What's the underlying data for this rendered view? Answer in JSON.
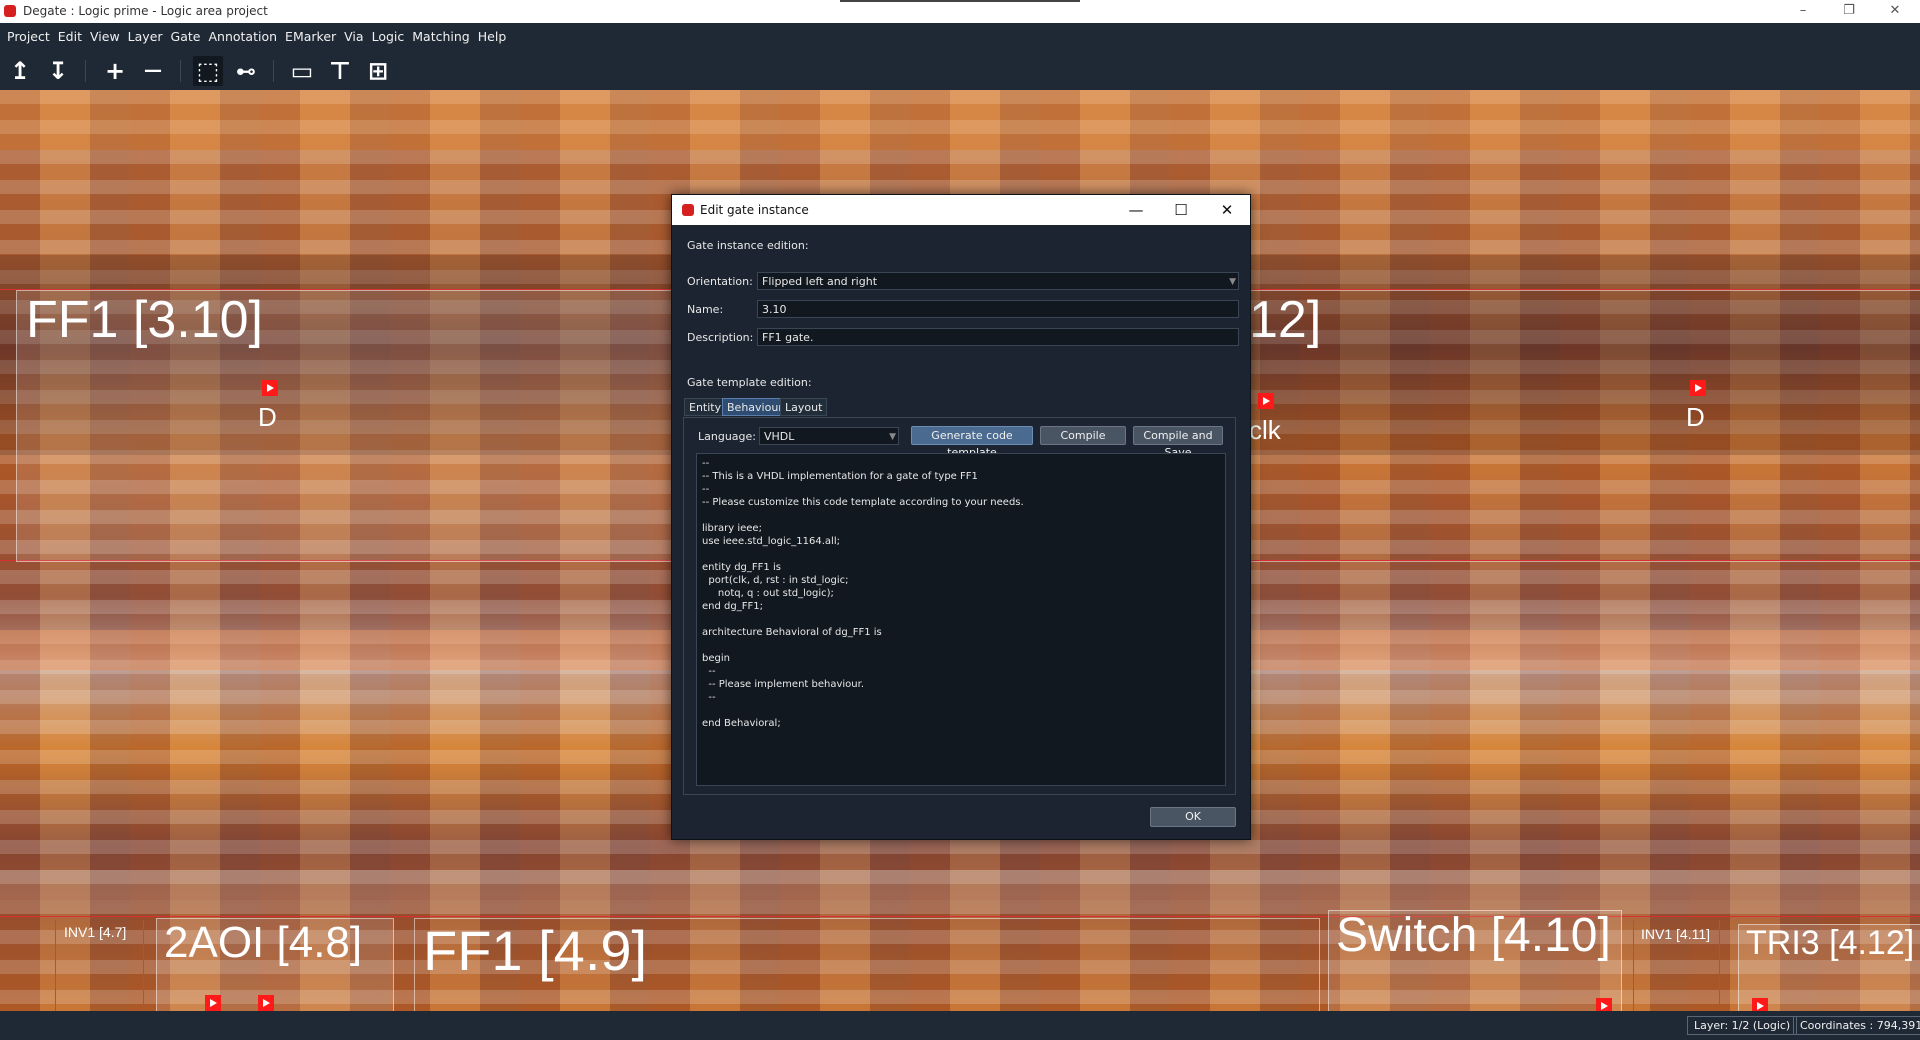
{
  "window": {
    "title": "Degate : Logic prime - Logic area project",
    "minimize": "–",
    "restore": "❐",
    "close": "✕"
  },
  "menu": [
    "Project",
    "Edit",
    "View",
    "Layer",
    "Gate",
    "Annotation",
    "EMarker",
    "Via",
    "Logic",
    "Matching",
    "Help"
  ],
  "toolbar": {
    "icons": [
      "layer-up-icon",
      "layer-down-icon",
      "zoom-in-icon",
      "zoom-out-icon",
      "area-selection-icon",
      "wire-tool-icon",
      "gate-library-icon",
      "template-icon",
      "layout-icon"
    ],
    "glyphs": {
      "up": "↥",
      "down": "↧",
      "plus": "+",
      "minus": "—",
      "select": "⬚",
      "wire": "⊷",
      "book": "▭",
      "tpl": "⊤",
      "layout": "⊞"
    }
  },
  "canvas": {
    "gates": [
      {
        "label": "FF1 [3.10]"
      },
      {
        "label": "12]"
      },
      {
        "label": "INV1 [4.7]"
      },
      {
        "label": "2AOI [4.8]"
      },
      {
        "label": "FF1 [4.9]"
      },
      {
        "label": "Switch [4.10]"
      },
      {
        "label": "INV1 [4.11]"
      },
      {
        "label": "TRI3 [4.12]"
      }
    ],
    "ports": [
      {
        "label": "D"
      },
      {
        "label": "clk"
      },
      {
        "label": "D"
      }
    ]
  },
  "dialog": {
    "title": "Edit gate instance",
    "buttons": {
      "minimize": "—",
      "maximize": "☐",
      "close": "✕"
    },
    "instance_section": "Gate instance edition:",
    "orientation_label": "Orientation:",
    "orientation_value": "Flipped left and right",
    "name_label": "Name:",
    "name_value": "3.10",
    "description_label": "Description:",
    "description_value": "FF1 gate.",
    "template_section": "Gate template edition:",
    "tabs": [
      "Entity",
      "Behaviour",
      "Layout"
    ],
    "active_tab": "Behaviour",
    "language_label": "Language:",
    "language_value": "VHDL",
    "generate_button": "Generate code template",
    "compile_button": "Compile",
    "compile_save_button": "Compile and Save",
    "code": "--\n-- This is a VHDL implementation for a gate of type FF1\n--\n-- Please customize this code template according to your needs.\n\nlibrary ieee;\nuse ieee.std_logic_1164.all;\n\nentity dg_FF1 is\n  port(clk, d, rst : in std_logic;\n     notq, q : out std_logic);\nend dg_FF1;\n\narchitecture Behavioral of dg_FF1 is\n\nbegin\n  --\n  -- Please implement behaviour.\n  --\n\nend Behavioral;",
    "ok_button": "OK"
  },
  "status": {
    "layer": "Layer: 1/2 (Logic)",
    "coordinates": "Coordinates : 794,391"
  },
  "colors": {
    "accent": "#2f4d72",
    "port_marker": "#ff1a1a",
    "app_icon": "#d62020"
  }
}
